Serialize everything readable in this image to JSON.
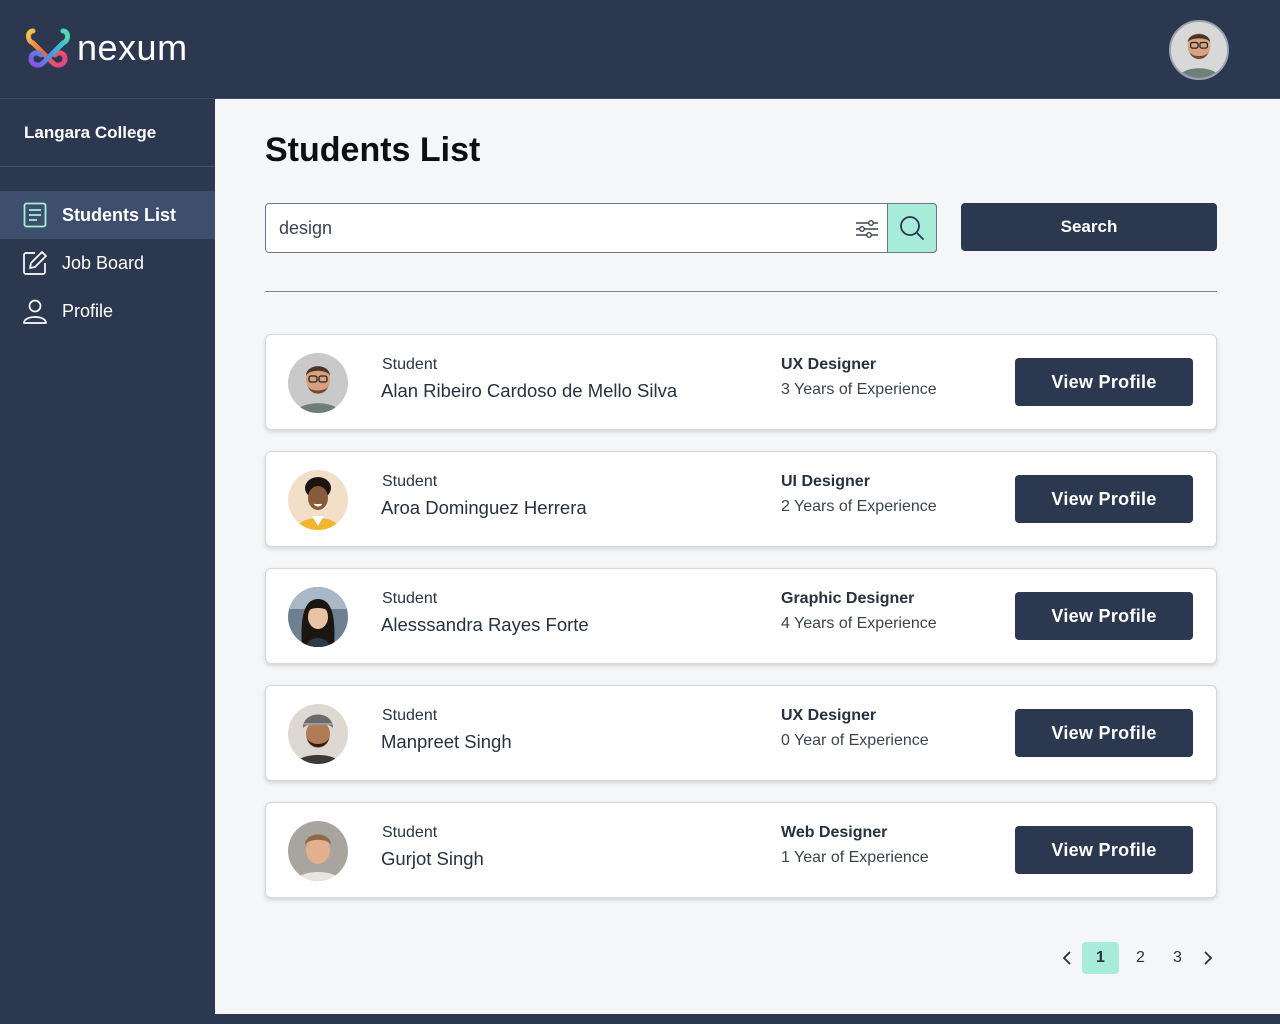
{
  "app": {
    "brand_name": "nexum"
  },
  "colors": {
    "navy": "#2b3850",
    "mint": "#a7ecd9",
    "background": "#f5f6f8"
  },
  "sidebar": {
    "organization": "Langara College",
    "items": [
      {
        "label": "Students List",
        "icon": "list-icon",
        "active": true
      },
      {
        "label": "Job Board",
        "icon": "edit-icon",
        "active": false
      },
      {
        "label": "Profile",
        "icon": "user-icon",
        "active": false
      }
    ]
  },
  "main": {
    "title": "Students List",
    "search": {
      "value": "design",
      "button_label": "Search"
    },
    "students": [
      {
        "role_label": "Student",
        "name": "Alan Ribeiro Cardoso de Mello Silva",
        "job_title": "UX Designer",
        "experience": "3 Years of Experience",
        "button_label": "View Profile"
      },
      {
        "role_label": "Student",
        "name": "Aroa Dominguez Herrera",
        "job_title": "UI Designer",
        "experience": "2 Years of Experience",
        "button_label": "View Profile"
      },
      {
        "role_label": "Student",
        "name": "Alesssandra Rayes Forte",
        "job_title": "Graphic Designer",
        "experience": "4 Years of Experience",
        "button_label": "View Profile"
      },
      {
        "role_label": "Student",
        "name": "Manpreet Singh",
        "job_title": "UX Designer",
        "experience": "0 Year of Experience",
        "button_label": "View Profile"
      },
      {
        "role_label": "Student",
        "name": "Gurjot Singh",
        "job_title": "Web Designer",
        "experience": "1 Year of Experience",
        "button_label": "View Profile"
      }
    ],
    "pagination": {
      "pages": [
        "1",
        "2",
        "3"
      ],
      "current": "1"
    }
  }
}
